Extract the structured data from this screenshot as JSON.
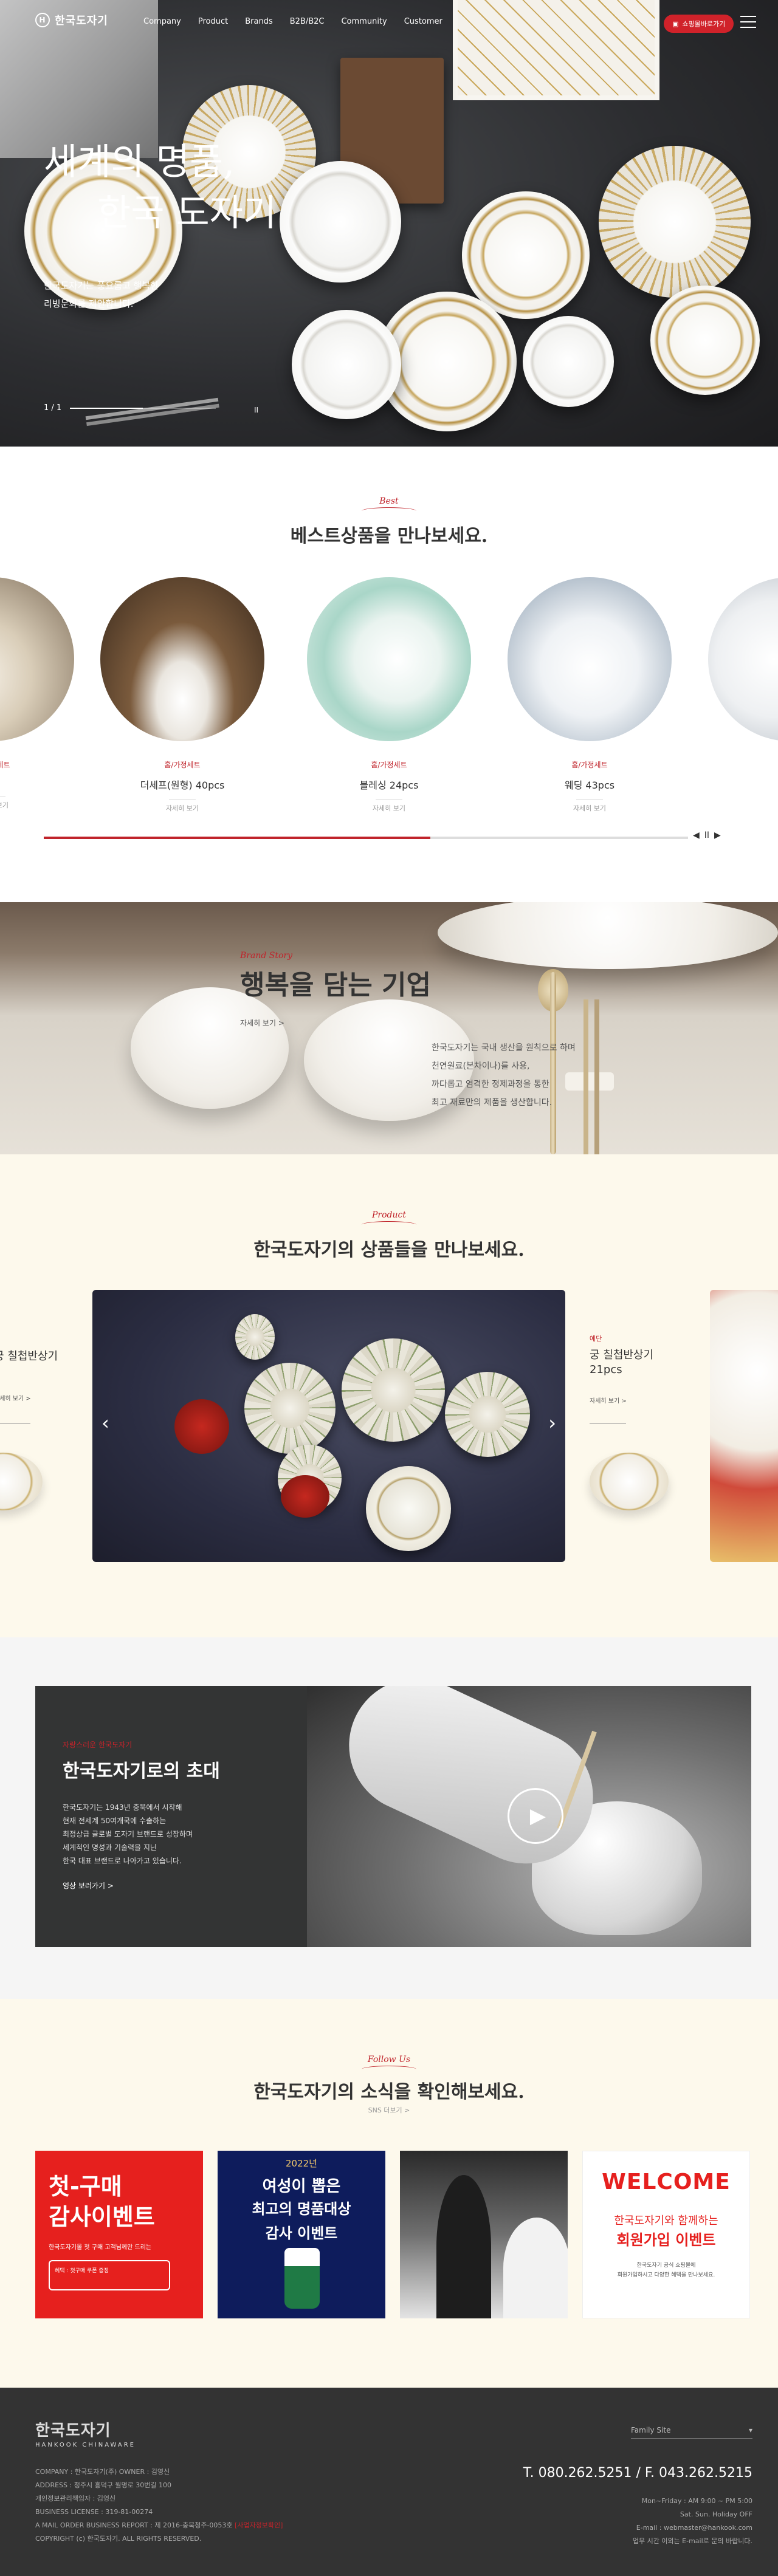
{
  "header": {
    "logo_text": "한국도자기",
    "nav": [
      "Company",
      "Product",
      "Brands",
      "B2B/B2C",
      "Community",
      "Customer"
    ],
    "shop_button": "쇼핑몰바로가기"
  },
  "hero": {
    "title_line1": "세계의 명품,",
    "title_line2": "한국 도자기",
    "desc_line1": "한국도자기는 풍요롭고 행복한",
    "desc_line2": "리빙문화를 제안합니다.",
    "pager": "1 / 1",
    "progress": 0.5,
    "pause_label": "II"
  },
  "best": {
    "label": "Best",
    "title": "베스트상품을 만나보세요.",
    "items": [
      {
        "category": "홈/가정세트",
        "name": "pcs",
        "more": "자세히 보기"
      },
      {
        "category": "홈/가정세트",
        "name": "더세프(원형) 40pcs",
        "more": "자세히 보기"
      },
      {
        "category": "홈/가정세트",
        "name": "블레싱 24pcs",
        "more": "자세히 보기"
      },
      {
        "category": "홈/가정세트",
        "name": "웨딩 43pcs",
        "more": "자세히 보기"
      }
    ],
    "progress": 0.6,
    "nav_prev": "◀",
    "nav_pause": "II",
    "nav_next": "▶"
  },
  "brand": {
    "label": "Brand Story",
    "title": "행복을 담는 기업",
    "more": "자세히 보기 >",
    "desc_line1": "한국도자기는 국내 생산을 원칙으로 하며",
    "desc_line2": "천연원료(본차이나)를 사용,",
    "desc_line3": "까다롭고 엄격한 정제과정을 통한",
    "desc_line4": "최고 재료만의 제품을 생산합니다."
  },
  "product": {
    "label": "Product",
    "title": "한국도자기의 상품들을 만나보세요.",
    "left_item": {
      "name_line1": "궁 칠첩반상기",
      "more": "자세히 보기 >"
    },
    "right_item": {
      "category": "예단",
      "name_line1": "궁 칠첩반상기",
      "name_line2": "21pcs",
      "more": "자세히 보기 >"
    },
    "prev": "‹",
    "next": "›"
  },
  "invite": {
    "label": "자랑스러운 한국도자기",
    "title": "한국도자기로의 초대",
    "desc_line1": "한국도자기는 1943년 충북에서 시작해",
    "desc_line2": "현재 전세계 50여개국에 수출하는",
    "desc_line3": "최정상급 글로벌 도자기 브랜드로 성장하며",
    "desc_line4": "세계적인 명성과 기술력을 지닌",
    "desc_line5": "한국 대표 브랜드로 나아가고 있습니다.",
    "more": "영상 보러가기 >",
    "play": "▶"
  },
  "follow": {
    "label": "Follow Us",
    "title": "한국도자기의 소식을 확인해보세요.",
    "sub": "SNS 더보기 >",
    "sns1": {
      "big_line1": "첫-구매",
      "big_line2": "감사이벤트",
      "small_line1": "한국도자기몰 첫 구매 고객님께만 드리는",
      "small_line2": "혜택 : 첫구매 쿠폰 증정"
    },
    "sns2": {
      "year": "2022년",
      "big_line1": "여성이 뽑은",
      "big_line2": "최고의 명품대상",
      "big_line3": "감사 이벤트"
    },
    "sns4": {
      "welcome": "WELCOME",
      "line1": "한국도자기와 함께하는",
      "line2": "회원가입 이벤트",
      "small_line1": "한국도자기 공식 쇼핑몰에",
      "small_line2": "회원가입하시고 다양한 혜택을 만나보세요."
    }
  },
  "footer": {
    "logo": "한국도자기",
    "logo_en": "HANKOOK CHINAWARE",
    "info_line1": "COMPANY : 한국도자기(주)   OWNER : 김영신",
    "info_line2": "ADDRESS : 청주시 흥덕구 월명로 30번길 100",
    "info_line3": "개인정보관리책임자 : 김영신",
    "info_line4": "BUSINESS LICENSE : 319-81-00274",
    "info_line5": "A MAIL ORDER BUSINESS REPORT : 제 2016-충북청주-0053호",
    "info_line5_link": "[사업자정보확인]",
    "info_line6": "COPYRIGHT (c) 한국도자기. ALL RIGHTS RESERVED.",
    "family_site": "Family Site",
    "tel": "T. 080.262.5251 / F. 043.262.5215",
    "hours_line1": "Mon~Friday : AM 9:00 ~ PM 5:00",
    "hours_line2": "Sat. Sun. Holiday OFF",
    "hours_line3": "E-mail : webmaster@hankook.com",
    "hours_line4": "업무 시간 이외는 E-mail로 문의 바랍니다."
  }
}
